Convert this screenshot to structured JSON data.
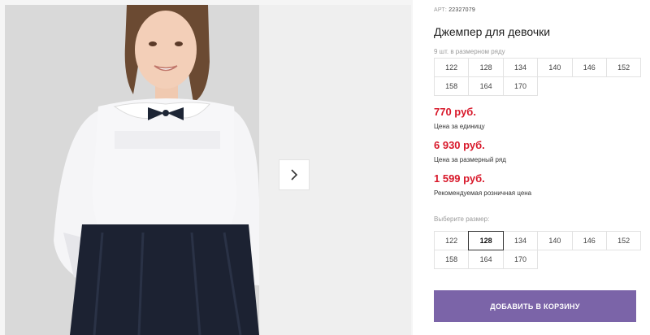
{
  "product": {
    "art_label": "АРТ:",
    "art_value": "22327079",
    "title": "Джемпер для девочки",
    "series_note": "9 шт. в размерном ряду"
  },
  "series_sizes": [
    "122",
    "128",
    "134",
    "140",
    "146",
    "152",
    "158",
    "164",
    "170"
  ],
  "prices": [
    {
      "value": "770 руб.",
      "label": "Цена за единицу"
    },
    {
      "value": "6 930 руб.",
      "label": "Цена за размерный ряд"
    },
    {
      "value": "1 599 руб.",
      "label": "Рекомендуемая розничная цена"
    }
  ],
  "size_select": {
    "label": "Выберите размер:",
    "options": [
      "122",
      "128",
      "134",
      "140",
      "146",
      "152",
      "158",
      "164",
      "170"
    ],
    "selected": "128"
  },
  "cart": {
    "add_label": "ДОБАВИТЬ В КОРЗИНУ"
  },
  "colors": {
    "accent": "#7b64a8",
    "price": "#d8182a"
  },
  "icons": {
    "next": "chevron-right-icon"
  }
}
